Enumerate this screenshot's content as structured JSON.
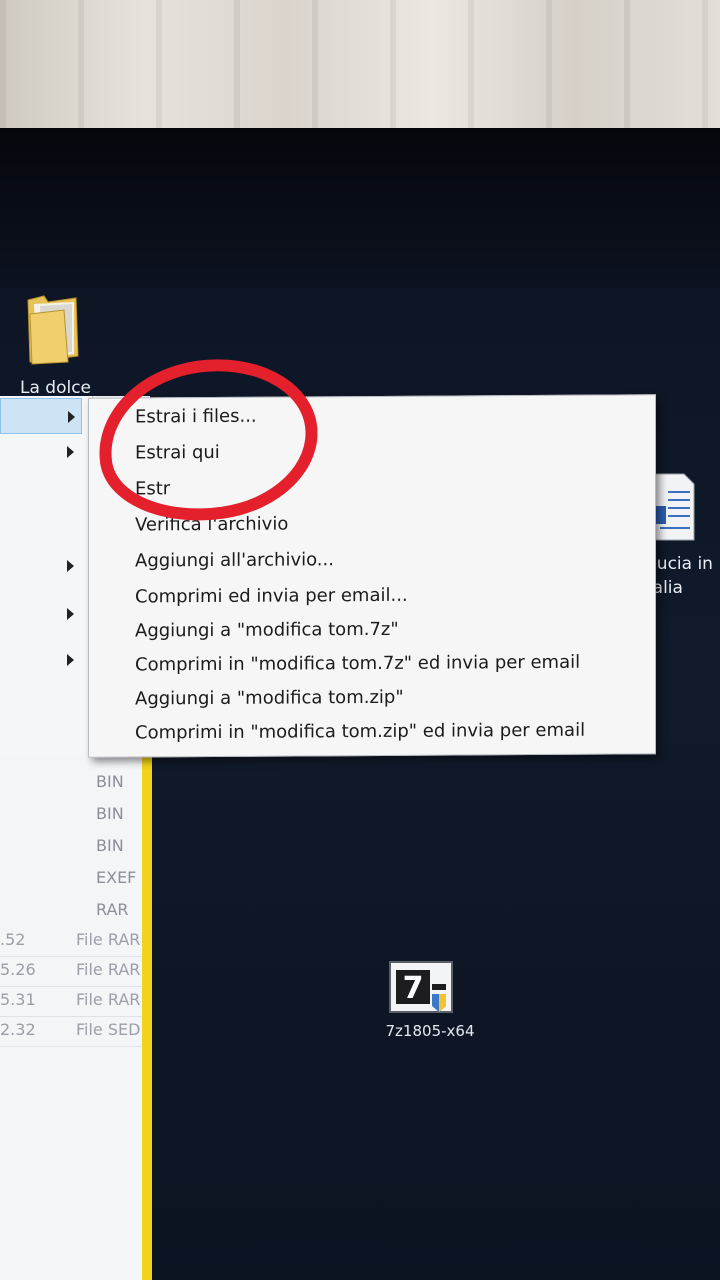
{
  "desktop": {
    "folder_label": "La dolce",
    "doc_label_line1": "ducia in",
    "doc_label_line2": "talia",
    "installer_label": "7z1805-x64",
    "installer_icon": "7zip-icon"
  },
  "explorer": {
    "types_partial": [
      "BIN",
      "BIN",
      "BIN",
      "EXEF",
      "RAR"
    ],
    "rows": [
      {
        "size": ".52",
        "type": "File RAR"
      },
      {
        "size": "5.26",
        "type": "File RAR"
      },
      {
        "size": "5.31",
        "type": "File RAR"
      },
      {
        "size": "2.32",
        "type": "File SED"
      }
    ]
  },
  "context_menu": {
    "items": [
      "Estrai i files...",
      "Estrai qui",
      "Estr",
      "Verifica l'archivio",
      "Aggiungi all'archivio...",
      "Comprimi ed invia per email...",
      "Aggiungi a \"modifica tom.7z\"",
      "Comprimi in \"modifica tom.7z\" ed invia per email",
      "Aggiungi a \"modifica tom.zip\"",
      "Comprimi in \"modifica tom.zip\" ed invia per email"
    ]
  },
  "annotation": {
    "color": "#e3202b"
  }
}
